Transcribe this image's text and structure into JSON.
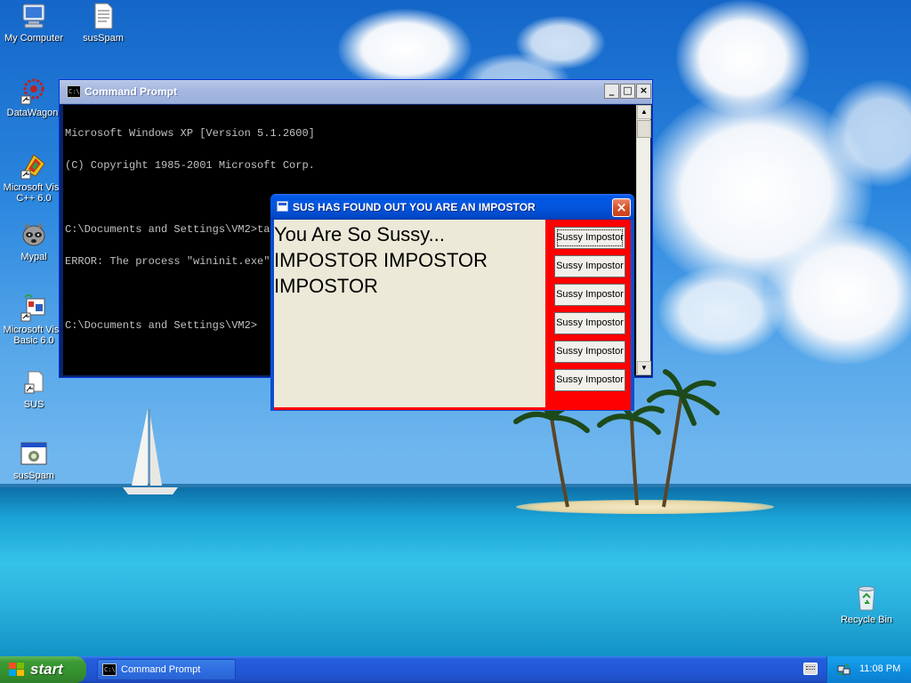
{
  "desktop": {
    "icons": [
      {
        "label": "My Computer"
      },
      {
        "label": "susSpam"
      },
      {
        "label": "DataWagon."
      },
      {
        "label": "Microsoft Visu C++ 6.0"
      },
      {
        "label": "Mypal"
      },
      {
        "label": "Microsoft Visu Basic 6.0"
      },
      {
        "label": "SUS"
      },
      {
        "label": "susSpam"
      },
      {
        "label": "Recycle Bin"
      }
    ]
  },
  "cmd_window": {
    "title": "Command Prompt",
    "icon_text": "C:\\",
    "minimize_label": "_",
    "maximize_label": "□",
    "close_label": "×",
    "lines": [
      "Microsoft Windows XP [Version 5.1.2600]",
      "(C) Copyright 1985-2001 Microsoft Corp.",
      "",
      "C:\\Documents and Settings\\VM2>taskkill /f /im wininit.exe",
      "ERROR: The process \"wininit.exe\" not found.",
      "",
      "C:\\Documents and Settings\\VM2>"
    ]
  },
  "sus_dialog": {
    "title": "SUS HAS FOUND OUT YOU ARE AN IMPOSTOR",
    "close_label": "×",
    "message_line1": "You Are So Sussy...",
    "message_line2": "IMPOSTOR IMPOSTOR",
    "message_line3": "IMPOSTOR",
    "buttons": [
      {
        "label": "Sussy Impostor"
      },
      {
        "label": "Sussy Impostor"
      },
      {
        "label": "Sussy Impostor"
      },
      {
        "label": "Sussy Impostor"
      },
      {
        "label": "Sussy Impostor"
      },
      {
        "label": "Sussy Impostor"
      }
    ],
    "accent_color": "#ff0000"
  },
  "taskbar": {
    "start_label": "start",
    "task_label": "Command Prompt",
    "clock": "11:08 PM"
  }
}
